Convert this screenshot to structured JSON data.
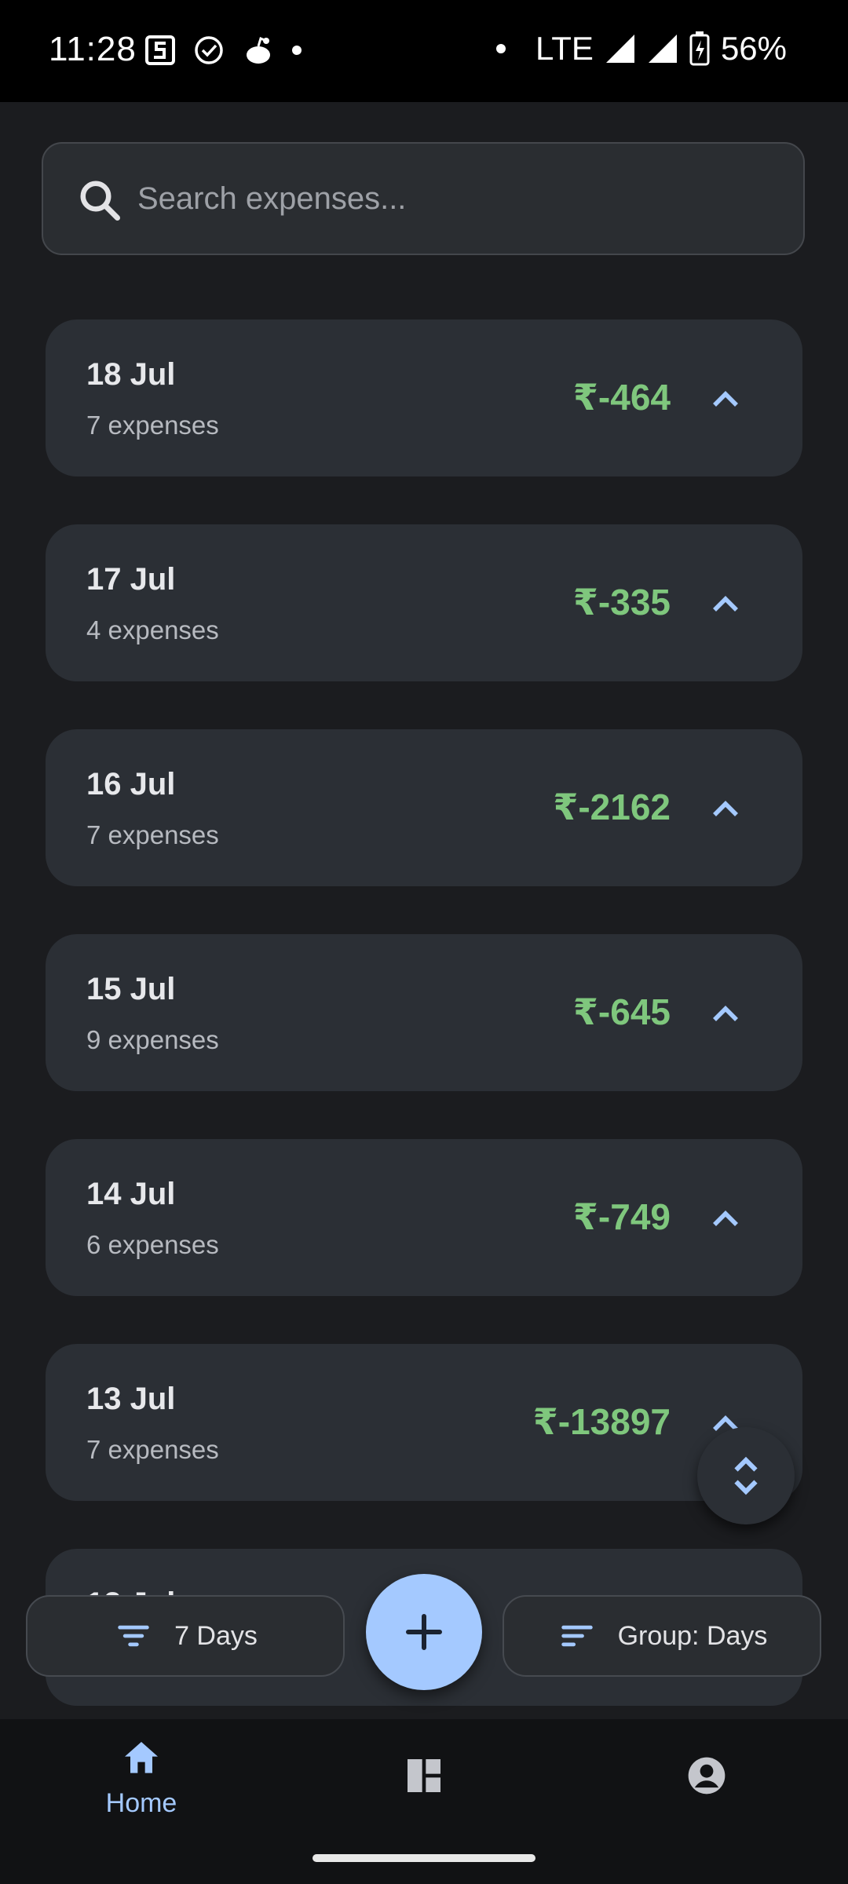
{
  "status_bar": {
    "time": "11:28",
    "network": "LTE",
    "battery": "56%"
  },
  "search": {
    "placeholder": "Search expenses..."
  },
  "groups": [
    {
      "date": "18 Jul",
      "count": "7 expenses",
      "amount": "₹-464"
    },
    {
      "date": "17 Jul",
      "count": "4 expenses",
      "amount": "₹-335"
    },
    {
      "date": "16 Jul",
      "count": "7 expenses",
      "amount": "₹-2162"
    },
    {
      "date": "15 Jul",
      "count": "9 expenses",
      "amount": "₹-645"
    },
    {
      "date": "14 Jul",
      "count": "6 expenses",
      "amount": "₹-749"
    },
    {
      "date": "13 Jul",
      "count": "7 expenses",
      "amount": "₹-13897"
    },
    {
      "date": "12 Jul",
      "count": "",
      "amount": ""
    }
  ],
  "controls": {
    "range_label": "7 Days",
    "group_label": "Group: Days"
  },
  "nav": {
    "home_label": "Home"
  },
  "colors": {
    "accent": "#a4c9ff",
    "amount": "#7fc77d",
    "card": "#2b2f35",
    "background": "#1b1c1f"
  }
}
